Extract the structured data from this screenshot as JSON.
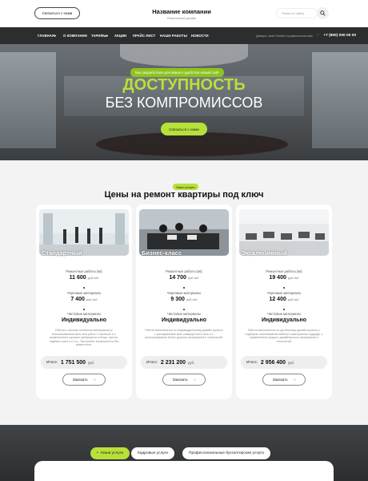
{
  "header": {
    "contact_label": "Связаться с нами",
    "company_name": "Название компании",
    "company_sub": "Уникальный дизайн",
    "search_placeholder": "Поиск по сайту"
  },
  "nav": {
    "items": [
      "ГЛАВНАЯ",
      "О КОМПАНИИ",
      "ТАРИФЫ",
      "АКЦИИ",
      "ПРАЙС-ЛИСТ",
      "НАШИ РАБОТЫ",
      "НОВОСТИ"
    ],
    "trust_text": "Доверь свой бизнес профессионалам",
    "phone": "+7 (800) 000 00 00"
  },
  "hero": {
    "tag": "Мы разработали для вашего удобства новый сайт",
    "title_line1": "ДОСТУПНОСТЬ",
    "title_line2": "БЕЗ КОМПРОМИССОВ",
    "button": "Связаться с нами"
  },
  "services": {
    "tag": "Наши услуги",
    "title": "Цены на ремонт квартиры под ключ",
    "label_work": "Ремонтные работы (кв)",
    "label_rough": "Черновые материалы",
    "label_finish": "Чистовые материалы",
    "unit": "руб./м2",
    "total_label": "Итого:",
    "currency": "руб.",
    "order_label": "Заказать",
    "cards": [
      {
        "title": "Стандартный",
        "work": "11 600",
        "rough": "7 400",
        "finish": "Индивидуально",
        "desc": "Работы с эконом сегментом материалов (с использованием всех этих работ и частично и с применением хороших материалов отбора, просто, надёжно (чисто и т.п.). Так пройти, возможность без ремонтного.",
        "total": "1 751 500"
      },
      {
        "title": "Бизнес-класс",
        "work": "14 700",
        "rough": "9 300",
        "finish": "Индивидуально",
        "desc": "Работа выполняется по индивидуальному дизайн-проекту с расширенным всех комфортной в пять и с использованием более дорогих материалов и технологий.",
        "total": "2 231 200"
      },
      {
        "title": "Эксклюзивный",
        "work": "19 400",
        "rough": "12 400",
        "finish": "Индивидуально",
        "desc": "Работа выполняется по детальному дизайн-проекту с подбором эксклюзивной мебели и материалов подряда, с применением редкого дизайнерского материалов и технологий.",
        "total": "2 956 400"
      }
    ]
  },
  "tabs": [
    "Наши услуги",
    "Кадровые услуги",
    "Профессиональные бухгалтерская услуга"
  ],
  "colors": {
    "accent": "#b8e03a",
    "dark": "#2b2d2e",
    "tag_green": "#8fc31f"
  }
}
